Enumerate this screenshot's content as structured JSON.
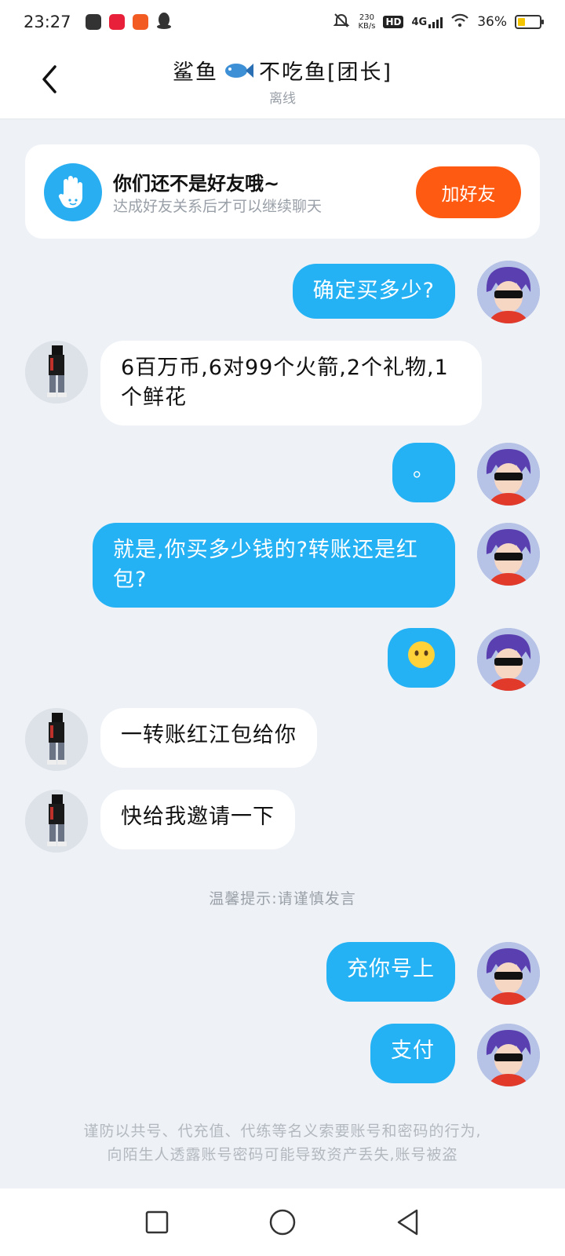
{
  "status_bar": {
    "time": "23:27",
    "net_speed": "230",
    "net_unit": "KB/s",
    "hd": "HD",
    "network": "4G",
    "battery": "36%",
    "battery_level": 0.36
  },
  "header": {
    "title_before_icon": "鲨鱼",
    "title_after_icon": "不吃鱼[团长]",
    "status": "离线"
  },
  "friend_banner": {
    "title": "你们还不是好友哦~",
    "subtitle": "达成好友关系后才可以继续聊天",
    "button": "加好友"
  },
  "messages": [
    {
      "from": "me",
      "text": "确定买多少?"
    },
    {
      "from": "them",
      "text": "6百万币,6对99个火箭,2个礼物,1个鲜花"
    },
    {
      "from": "me",
      "text": "。"
    },
    {
      "from": "me",
      "text": "就是,你买多少钱的?转账还是红包?"
    },
    {
      "from": "me",
      "text": "😶",
      "kind": "emoji"
    },
    {
      "from": "them",
      "text": "一转账红江包给你"
    },
    {
      "from": "them",
      "text": "快给我邀请一下"
    },
    {
      "from": "me",
      "text": "充你号上"
    },
    {
      "from": "me",
      "text": "支付"
    }
  ],
  "notice": "温馨提示:请谨慎发言",
  "footer_warning": {
    "line1": "谨防以共号、代充值、代练等名义索要账号和密码的行为,",
    "line2": "向陌生人透露账号密码可能导致资产丢失,账号被盗"
  },
  "colors": {
    "my_bubble": "#25b2f4",
    "their_bubble": "#ffffff",
    "background": "#eef2f7",
    "add_friend_button": "#ff5a12"
  }
}
